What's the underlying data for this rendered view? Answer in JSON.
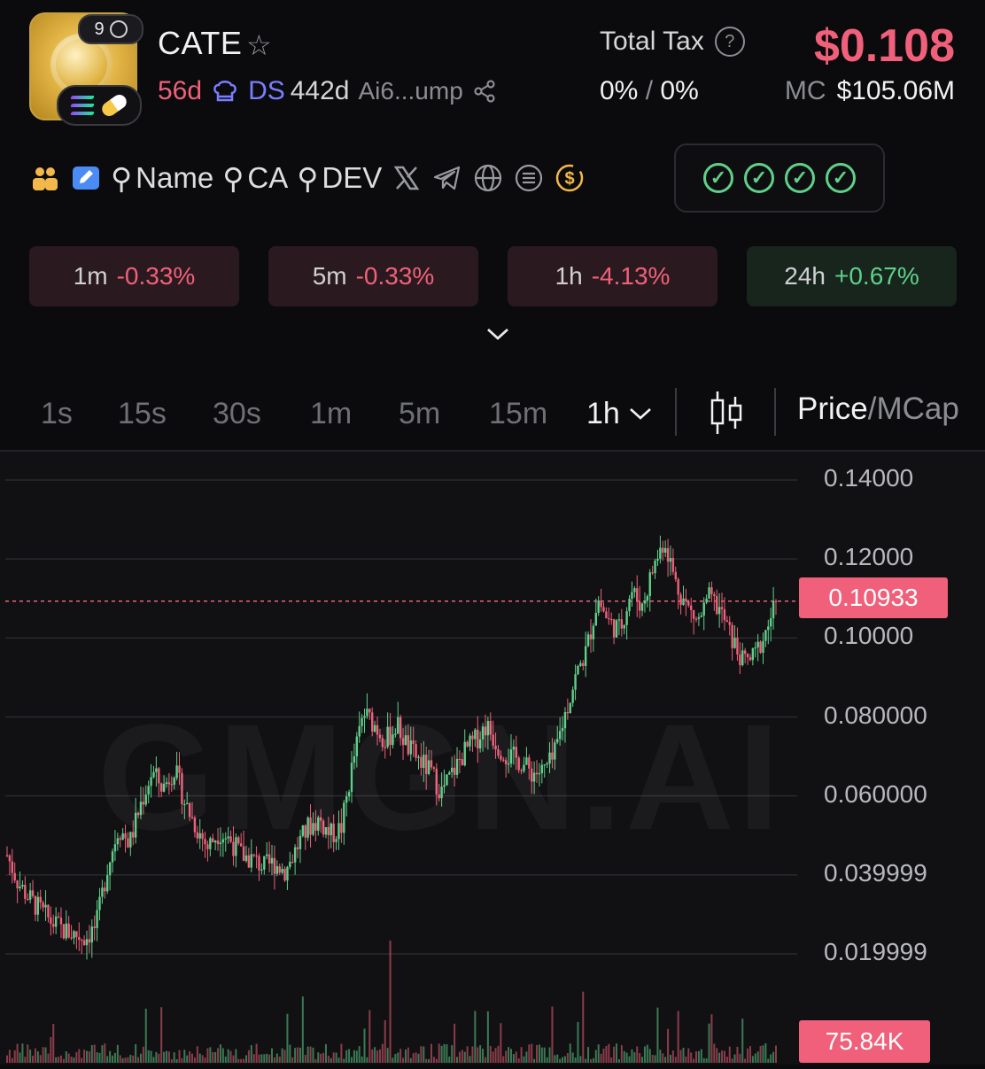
{
  "token": {
    "badge_count": "9",
    "name": "CATE",
    "age": "56d",
    "dev_tag": "DS",
    "dev_age": "442d",
    "address_short": "Ai6...ump"
  },
  "tax": {
    "label": "Total Tax",
    "buy": "0%",
    "separator": "/",
    "sell": "0%"
  },
  "price": {
    "value": "$0.108",
    "mc_label": "MC",
    "mc_value": "$105.06M"
  },
  "links": {
    "name_label": "Name",
    "ca_label": "CA",
    "dev_label": "DEV",
    "icons": [
      "people-icon",
      "edit-icon",
      "search-icon",
      "x-icon",
      "telegram-icon",
      "globe-icon",
      "list-icon",
      "dollar-icon"
    ]
  },
  "changes": [
    {
      "label": "1m",
      "value": "-0.33%"
    },
    {
      "label": "5m",
      "value": "-0.33%"
    },
    {
      "label": "1h",
      "value": "-4.13%"
    },
    {
      "label": "24h",
      "value": "+0.67%"
    }
  ],
  "timeframes": {
    "items": [
      "1s",
      "15s",
      "30s",
      "1m",
      "5m",
      "15m"
    ],
    "active": "1h",
    "price_label": "Price",
    "divider": "/",
    "mcap_label": "MCap"
  },
  "colors": {
    "up": "#5fd08a",
    "down": "#f0607a",
    "background": "#0b0b0d"
  },
  "chart_data": {
    "type": "candlestick",
    "y_ticks": [
      "0.14000",
      "0.12000",
      "0.10000",
      "0.080000",
      "0.060000",
      "0.039999",
      "0.019999"
    ],
    "ylim": [
      0.0199,
      0.14
    ],
    "current_price": "0.10933",
    "volume_label": "75.84K",
    "watermark": "GMGN.AI",
    "close_path": [
      0.045,
      0.038,
      0.034,
      0.031,
      0.028,
      0.026,
      0.025,
      0.024,
      0.027,
      0.042,
      0.052,
      0.048,
      0.058,
      0.066,
      0.062,
      0.067,
      0.058,
      0.052,
      0.047,
      0.051,
      0.049,
      0.045,
      0.044,
      0.042,
      0.043,
      0.041,
      0.047,
      0.052,
      0.054,
      0.05,
      0.052,
      0.068,
      0.081,
      0.078,
      0.074,
      0.078,
      0.072,
      0.069,
      0.066,
      0.061,
      0.066,
      0.071,
      0.074,
      0.078,
      0.073,
      0.07,
      0.069,
      0.066,
      0.066,
      0.069,
      0.08,
      0.09,
      0.097,
      0.11,
      0.104,
      0.102,
      0.112,
      0.108,
      0.118,
      0.125,
      0.114,
      0.108,
      0.104,
      0.11,
      0.107,
      0.1,
      0.094,
      0.095,
      0.101,
      0.109
    ]
  }
}
